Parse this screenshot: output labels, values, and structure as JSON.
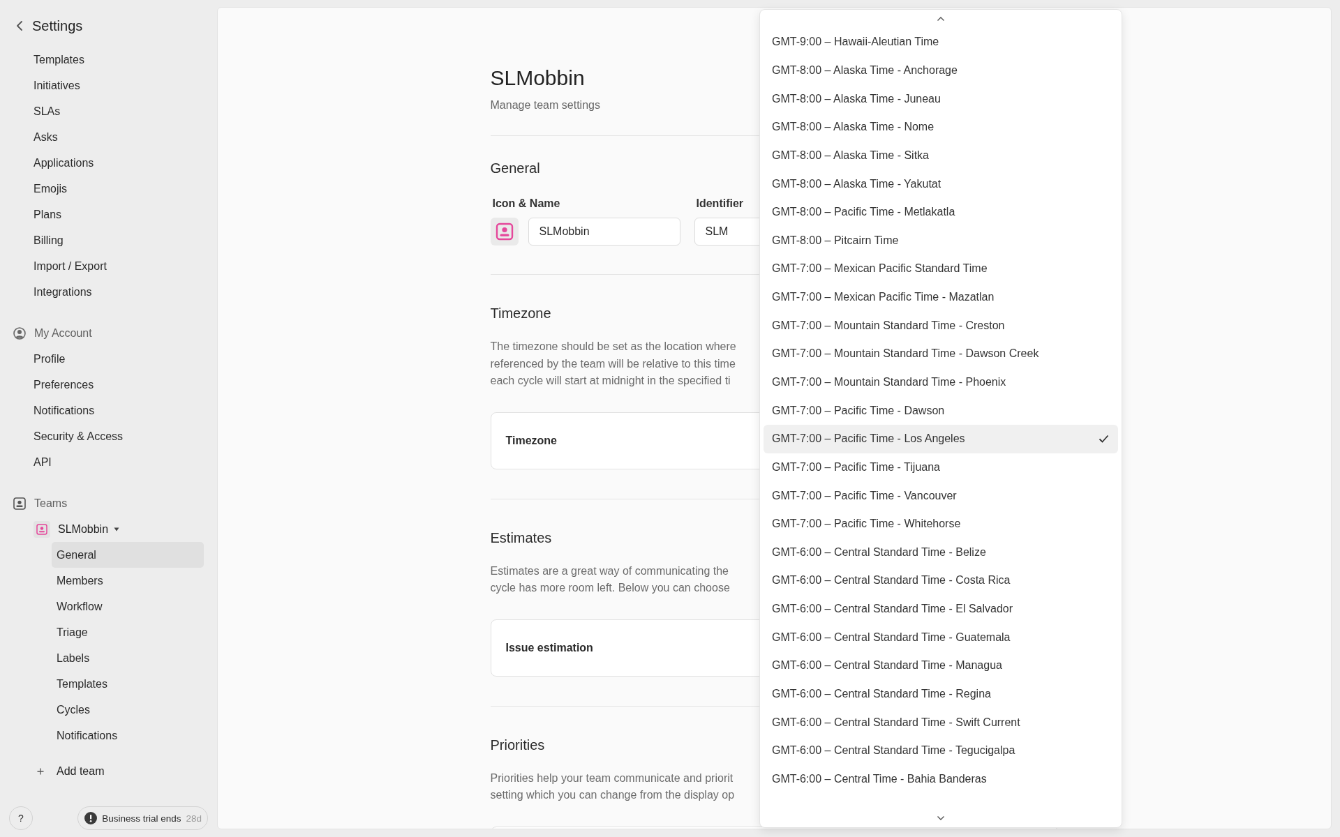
{
  "sidebar": {
    "title": "Settings",
    "workspace_items": [
      {
        "label": "Templates",
        "selected": false
      },
      {
        "label": "Initiatives",
        "selected": false
      },
      {
        "label": "SLAs",
        "selected": false
      },
      {
        "label": "Asks",
        "selected": false
      },
      {
        "label": "Applications",
        "selected": false
      },
      {
        "label": "Emojis",
        "selected": false
      },
      {
        "label": "Plans",
        "selected": false
      },
      {
        "label": "Billing",
        "selected": false
      },
      {
        "label": "Import / Export",
        "selected": false
      },
      {
        "label": "Integrations",
        "selected": false
      }
    ],
    "account": {
      "title": "My Account",
      "items": [
        {
          "label": "Profile",
          "selected": false
        },
        {
          "label": "Preferences",
          "selected": false
        },
        {
          "label": "Notifications",
          "selected": false
        },
        {
          "label": "Security & Access",
          "selected": false
        },
        {
          "label": "API",
          "selected": false
        }
      ]
    },
    "teams": {
      "title": "Teams",
      "team": {
        "name": "SLMobbin",
        "expanded": true,
        "items": [
          {
            "label": "General",
            "selected": true
          },
          {
            "label": "Members",
            "selected": false
          },
          {
            "label": "Workflow",
            "selected": false
          },
          {
            "label": "Triage",
            "selected": false
          },
          {
            "label": "Labels",
            "selected": false
          },
          {
            "label": "Templates",
            "selected": false
          },
          {
            "label": "Cycles",
            "selected": false
          },
          {
            "label": "Notifications",
            "selected": false
          }
        ]
      },
      "add_label": "Add team"
    },
    "help": "?",
    "trial": {
      "label": "Business trial ends",
      "days": "28d"
    }
  },
  "main": {
    "title": "SLMobbin",
    "subtitle": "Manage team settings",
    "sections": [
      {
        "kind": "general",
        "heading": "General",
        "name_label": "Icon & Name",
        "name_value": "SLMobbin",
        "identifier_label": "Identifier",
        "identifier_value": "SLM"
      },
      {
        "kind": "setting",
        "heading": "Timezone",
        "description": [
          "The timezone should be set as the location where",
          "referenced by the team will be relative to this time",
          "each cycle will start at midnight in the specified ti"
        ],
        "card_label": "Timezone"
      },
      {
        "kind": "setting",
        "heading": "Estimates",
        "description": [
          "Estimates are a great way of communicating the",
          "cycle has more room left. Below you can choose"
        ],
        "card_label": "Issue estimation"
      },
      {
        "kind": "setting",
        "heading": "Priorities",
        "description": [
          "Priorities help your team communicate and priorit",
          "setting which you can change from the display op"
        ]
      }
    ]
  },
  "timezone_dropdown": {
    "options": [
      {
        "label": "GMT-9:00 – Hawaii-Aleutian Time",
        "selected": false
      },
      {
        "label": "GMT-8:00 – Alaska Time - Anchorage",
        "selected": false
      },
      {
        "label": "GMT-8:00 – Alaska Time - Juneau",
        "selected": false
      },
      {
        "label": "GMT-8:00 – Alaska Time - Nome",
        "selected": false
      },
      {
        "label": "GMT-8:00 – Alaska Time - Sitka",
        "selected": false
      },
      {
        "label": "GMT-8:00 – Alaska Time - Yakutat",
        "selected": false
      },
      {
        "label": "GMT-8:00 – Pacific Time - Metlakatla",
        "selected": false
      },
      {
        "label": "GMT-8:00 – Pitcairn Time",
        "selected": false
      },
      {
        "label": "GMT-7:00 – Mexican Pacific Standard Time",
        "selected": false
      },
      {
        "label": "GMT-7:00 – Mexican Pacific Time - Mazatlan",
        "selected": false
      },
      {
        "label": "GMT-7:00 – Mountain Standard Time - Creston",
        "selected": false
      },
      {
        "label": "GMT-7:00 – Mountain Standard Time - Dawson Creek",
        "selected": false
      },
      {
        "label": "GMT-7:00 – Mountain Standard Time - Phoenix",
        "selected": false
      },
      {
        "label": "GMT-7:00 – Pacific Time - Dawson",
        "selected": false
      },
      {
        "label": "GMT-7:00 – Pacific Time - Los Angeles",
        "selected": true
      },
      {
        "label": "GMT-7:00 – Pacific Time - Tijuana",
        "selected": false
      },
      {
        "label": "GMT-7:00 – Pacific Time - Vancouver",
        "selected": false
      },
      {
        "label": "GMT-7:00 – Pacific Time - Whitehorse",
        "selected": false
      },
      {
        "label": "GMT-6:00 – Central Standard Time - Belize",
        "selected": false
      },
      {
        "label": "GMT-6:00 – Central Standard Time - Costa Rica",
        "selected": false
      },
      {
        "label": "GMT-6:00 – Central Standard Time - El Salvador",
        "selected": false
      },
      {
        "label": "GMT-6:00 – Central Standard Time - Guatemala",
        "selected": false
      },
      {
        "label": "GMT-6:00 – Central Standard Time - Managua",
        "selected": false
      },
      {
        "label": "GMT-6:00 – Central Standard Time - Regina",
        "selected": false
      },
      {
        "label": "GMT-6:00 – Central Standard Time - Swift Current",
        "selected": false
      },
      {
        "label": "GMT-6:00 – Central Standard Time - Tegucigalpa",
        "selected": false
      },
      {
        "label": "GMT-6:00 – Central Time - Bahia Banderas",
        "selected": false
      }
    ]
  }
}
